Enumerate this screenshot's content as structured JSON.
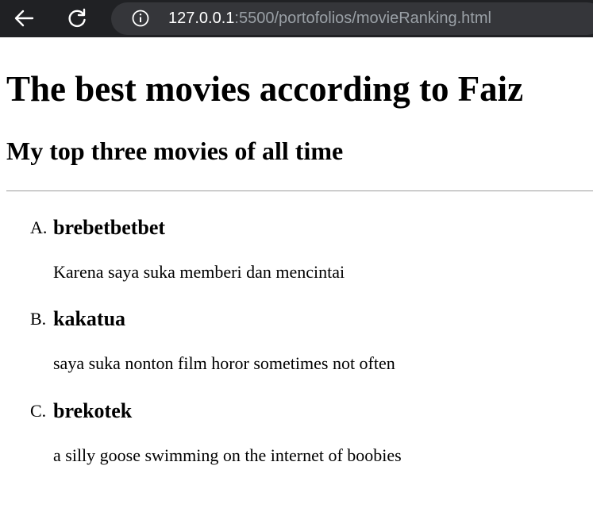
{
  "browser": {
    "url_host": "127.0.0.1",
    "url_rest": ":5500/portofolios/movieRanking.html",
    "back_icon": "back-arrow-icon",
    "reload_icon": "reload-icon",
    "info_icon": "info-icon"
  },
  "page": {
    "heading": "The best movies according to Faiz",
    "subheading": "My top three movies of all time",
    "movies": [
      {
        "marker": "A.",
        "title": "brebetbetbet",
        "description": "Karena saya suka memberi dan mencintai"
      },
      {
        "marker": "B.",
        "title": "kakatua",
        "description": "saya suka nonton film horor sometimes not often"
      },
      {
        "marker": "C.",
        "title": "brekotek",
        "description": "a silly goose swimming on the internet of boobies"
      }
    ]
  },
  "colors": {
    "browser_bar": "#202124",
    "omnibox": "#35363a",
    "url_host": "#ffffff",
    "url_rest": "#9aa0a6",
    "page_bg": "#ffffff",
    "divider": "#9a9a9a"
  }
}
